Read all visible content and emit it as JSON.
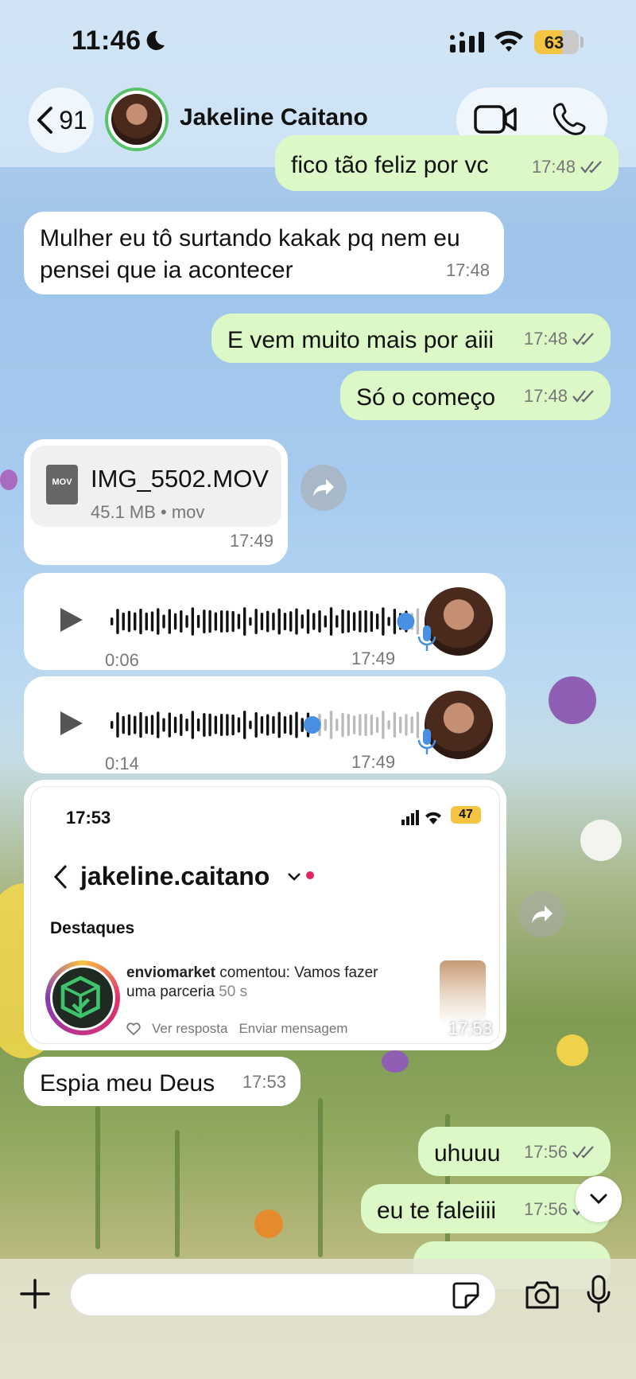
{
  "status_bar": {
    "time": "11:46",
    "battery": "63",
    "battery_level": 0.63
  },
  "header": {
    "back_count": "91",
    "contact_name": "Jakeline Caitano"
  },
  "messages": {
    "m0": {
      "text": "fico tão feliz por vc",
      "time": "17:48"
    },
    "m1": {
      "text": "Mulher eu tô surtando kakak pq nem eu\npensei que ia acontecer",
      "time": "17:48"
    },
    "m2": {
      "text": "E vem muito mais por aiii",
      "time": "17:48"
    },
    "m3": {
      "text": "Só o começo",
      "time": "17:48"
    },
    "file": {
      "name": "IMG_5502.MOV",
      "info": "45.1 MB • mov",
      "icon_label": "MOV",
      "time": "17:49"
    },
    "voice1": {
      "duration": "0:06",
      "time": "17:49",
      "progress": 0.95
    },
    "voice2": {
      "duration": "0:14",
      "time": "17:49",
      "progress": 0.65
    },
    "screenshot": {
      "status_time": "17:53",
      "battery": "47",
      "username": "jakeline.caitano",
      "section": "Destaques",
      "commenter": "enviomarket",
      "comment": " comentou: Vamos fazer uma parceria ",
      "age": "50 s",
      "reply": "Ver resposta",
      "send": "Enviar mensagem",
      "time": "17:53"
    },
    "m4": {
      "text": "Espia meu Deus",
      "time": "17:53"
    },
    "m5": {
      "text": "uhuuu",
      "time": "17:56"
    },
    "m6": {
      "text": "eu te faleiiii",
      "time": "17:56"
    }
  },
  "composer": {
    "placeholder": ""
  },
  "colors": {
    "incoming": "#ffffff",
    "outgoing": "#dcf8c6",
    "accent_blue": "#4a90e2",
    "online_ring": "#58c46a"
  }
}
